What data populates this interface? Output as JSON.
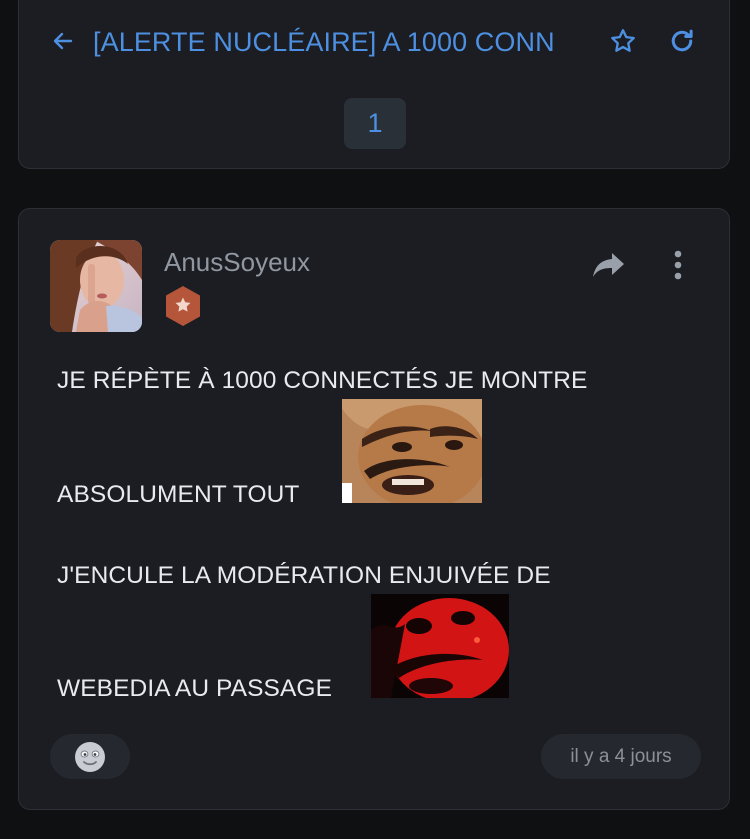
{
  "topic": {
    "title": "[ALERTE NUCLÉAIRE] A 1000 CONN",
    "current_page": "1",
    "icons": {
      "back": "arrow-left-icon",
      "favorite": "star-icon",
      "refresh": "refresh-icon"
    },
    "accent_color": "#4d8fe0"
  },
  "post": {
    "author": "AnusSoyeux",
    "avatar_icon": "user-avatar-photo",
    "rank_icon": "star-badge-icon",
    "rank_color": "#b5553a",
    "lines": [
      "JE RÉPÈTE À 1000 CONNECTÉS JE MONTRE",
      "ABSOLUMENT TOUT",
      "J'ENCULE LA MODÉRATION ENJUIVÉE DE",
      "WEBEDIA AU PASSAGE"
    ],
    "stickers": [
      "laughing-man-sticker",
      "red-demon-face-sticker"
    ],
    "icons": {
      "share": "share-arrow-icon",
      "more": "more-vertical-icon",
      "reaction": "smiley-reaction-icon"
    },
    "date": "il y a 4 jours"
  }
}
